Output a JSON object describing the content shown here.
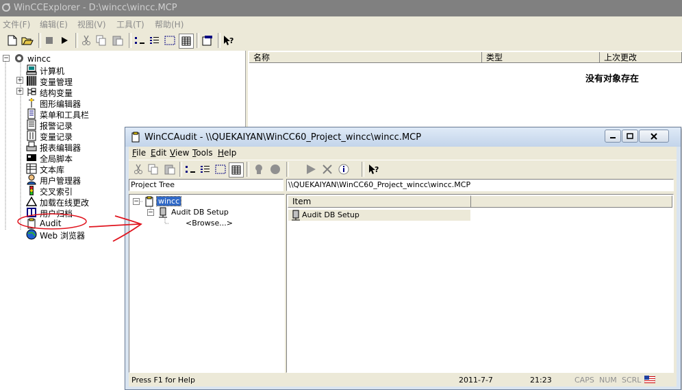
{
  "window": {
    "title": "WinCCExplorer - D:\\wincc\\wincc.MCP"
  },
  "menubar": {
    "items": [
      "文件(F)",
      "编辑(E)",
      "视图(V)",
      "工具(T)",
      "帮助(H)"
    ]
  },
  "toolbar": {
    "icons": [
      "new-icon",
      "open-icon",
      "stop-icon",
      "run-icon",
      "cut-icon",
      "copy-icon",
      "paste-icon",
      "small-icons-icon",
      "list-icon",
      "details-icon",
      "grid-icon",
      "properties-icon",
      "help-icon"
    ]
  },
  "tree": {
    "root": "wincc",
    "items": [
      {
        "label": "计算机",
        "icon": "computer-icon"
      },
      {
        "label": "变量管理",
        "icon": "tag-management-icon",
        "expandable": true
      },
      {
        "label": "结构变量",
        "icon": "structure-icon",
        "expandable": true
      },
      {
        "label": "图形编辑器",
        "icon": "graphics-designer-icon"
      },
      {
        "label": "菜单和工具栏",
        "icon": "menu-toolbar-icon"
      },
      {
        "label": "报警记录",
        "icon": "alarm-logging-icon"
      },
      {
        "label": "变量记录",
        "icon": "tag-logging-icon"
      },
      {
        "label": "报表编辑器",
        "icon": "report-designer-icon"
      },
      {
        "label": "全局脚本",
        "icon": "global-script-icon"
      },
      {
        "label": "文本库",
        "icon": "text-library-icon"
      },
      {
        "label": "用户管理器",
        "icon": "user-administrator-icon"
      },
      {
        "label": "交叉索引",
        "icon": "cross-reference-icon"
      },
      {
        "label": "加载在线更改",
        "icon": "load-online-changes-icon"
      },
      {
        "label": "用户归档",
        "icon": "user-archive-icon"
      },
      {
        "label": "Audit",
        "icon": "audit-icon"
      },
      {
        "label": "Web 浏览器",
        "icon": "web-navigator-icon"
      }
    ]
  },
  "right_pane": {
    "columns": [
      "名称",
      "类型",
      "上次更改"
    ],
    "empty_message": "没有对象存在"
  },
  "audit": {
    "title": "WinCCAudit - \\\\QUEKAIYAN\\WinCC60_Project_wincc\\wincc.MCP",
    "menu": [
      {
        "label": "File",
        "mnemonic": "F",
        "rest": "ile"
      },
      {
        "label": "Edit",
        "mnemonic": "E",
        "rest": "dit"
      },
      {
        "label": "View",
        "mnemonic": "V",
        "rest": "iew"
      },
      {
        "label": "Tools",
        "mnemonic": "T",
        "rest": "ools"
      },
      {
        "label": "Help",
        "mnemonic": "H",
        "rest": "elp"
      }
    ],
    "project_tree_label": "Project Tree",
    "path": "\\\\QUEKAIYAN\\WinCC60_Project_wincc\\wincc.MCP",
    "tree_root": "wincc",
    "tree_child": "Audit DB Setup",
    "tree_leaf": "<Browse...>",
    "list_column": "Item",
    "list_item": "Audit DB Setup",
    "status": {
      "help": "Press F1 for Help",
      "date": "2011-7-7",
      "time": "21:23",
      "caps": "CAPS",
      "num": "NUM",
      "scrl": "SCRL"
    }
  },
  "colors": {
    "annotation": "#e0141e",
    "selection": "#3169c6"
  }
}
